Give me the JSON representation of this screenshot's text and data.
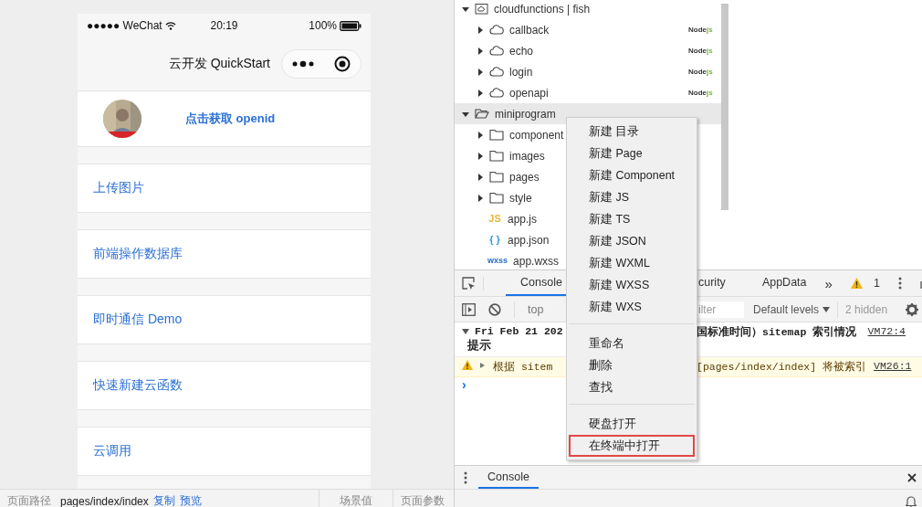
{
  "phone": {
    "status": {
      "carrier": "●●●●● WeChat",
      "time": "20:19",
      "battery": "100%"
    },
    "nav_title": "云开发 QuickStart",
    "profile": {
      "action": "点击获取 openid"
    },
    "menu_items": [
      {
        "label": "上传图片"
      },
      {
        "label": "前端操作数据库"
      },
      {
        "label": "即时通信 Demo"
      },
      {
        "label": "快速新建云函数"
      },
      {
        "label": "云调用"
      }
    ]
  },
  "status_bar": {
    "path_label": "页面路径",
    "path": "pages/index/index",
    "links": [
      "复制",
      "预览"
    ],
    "scene": "场景值",
    "params": "页面参数"
  },
  "file_tree": [
    {
      "kind": "cloudroot",
      "label": "cloudfunctions | fish",
      "expanded": true,
      "children": [
        {
          "kind": "cloudfunction",
          "label": "callback",
          "expanded": false,
          "badge": {
            "text": "Node",
            "suffix": "js"
          }
        },
        {
          "kind": "cloudfunction",
          "label": "echo",
          "expanded": false,
          "badge": {
            "text": "Node",
            "suffix": "js"
          }
        },
        {
          "kind": "cloudfunction",
          "label": "login",
          "expanded": false,
          "badge": {
            "text": "Node",
            "suffix": "js"
          }
        },
        {
          "kind": "cloudfunction",
          "label": "openapi",
          "expanded": false,
          "badge": {
            "text": "Node",
            "suffix": "js"
          }
        }
      ]
    },
    {
      "kind": "folder",
      "label": "miniprogram",
      "expanded": true,
      "selected": true,
      "children": [
        {
          "kind": "folder",
          "label": "component",
          "expanded": false,
          "selected": false
        },
        {
          "kind": "folder",
          "label": "images",
          "expanded": false,
          "selected": false
        },
        {
          "kind": "folder",
          "label": "pages",
          "expanded": false,
          "selected": false
        },
        {
          "kind": "folder",
          "label": "style",
          "expanded": false,
          "selected": false
        },
        {
          "kind": "file",
          "label": "app.js",
          "icon_text": "JS",
          "color": "#e8b63a"
        },
        {
          "kind": "file",
          "label": "app.json",
          "icon_text": "{ }",
          "color": "#3a9ad9"
        },
        {
          "kind": "file",
          "label": "app.wxss",
          "icon_text": "wxss",
          "color": "#2b6cc4"
        }
      ]
    }
  ],
  "devtools": {
    "tabs": [
      {
        "label": "Console",
        "selected": true
      },
      {
        "label": "curity",
        "selected": false
      },
      {
        "label": "AppData",
        "selected": false
      }
    ],
    "more_tabs": "»",
    "warning_count": "1",
    "toolbar": {
      "context": "top",
      "filter_placeholder": "ilter",
      "levels": "Default levels",
      "hidden": "2 hidden"
    },
    "messages": [
      {
        "kind": "info",
        "left": "Fri Feb 21 202",
        "left_line2": "提示",
        "right": "国标准时间）sitemap 索引情况",
        "source": "VM72:4"
      },
      {
        "kind": "warning",
        "left": "根据 sitem",
        "right": "[pages/index/index] 将被索引",
        "source": "VM26:1"
      }
    ],
    "prompt": "›"
  },
  "drawer": {
    "tabs": [
      {
        "label": "Console",
        "selected": true
      }
    ]
  },
  "context_menu": {
    "groups": [
      [
        {
          "label": "新建 目录",
          "selected": false
        },
        {
          "label": "新建 Page",
          "selected": false
        },
        {
          "label": "新建 Component",
          "selected": false
        },
        {
          "label": "新建 JS",
          "selected": false
        },
        {
          "label": "新建 TS",
          "selected": false
        },
        {
          "label": "新建 JSON",
          "selected": false
        },
        {
          "label": "新建 WXML",
          "selected": false
        },
        {
          "label": "新建 WXSS",
          "selected": false
        },
        {
          "label": "新建 WXS",
          "selected": false
        }
      ],
      [
        {
          "label": "重命名",
          "selected": false
        },
        {
          "label": "删除",
          "selected": false
        },
        {
          "label": "查找",
          "selected": false
        }
      ],
      [
        {
          "label": "硬盘打开",
          "selected": false
        },
        {
          "label": "在终端中打开",
          "selected": true
        }
      ]
    ]
  }
}
